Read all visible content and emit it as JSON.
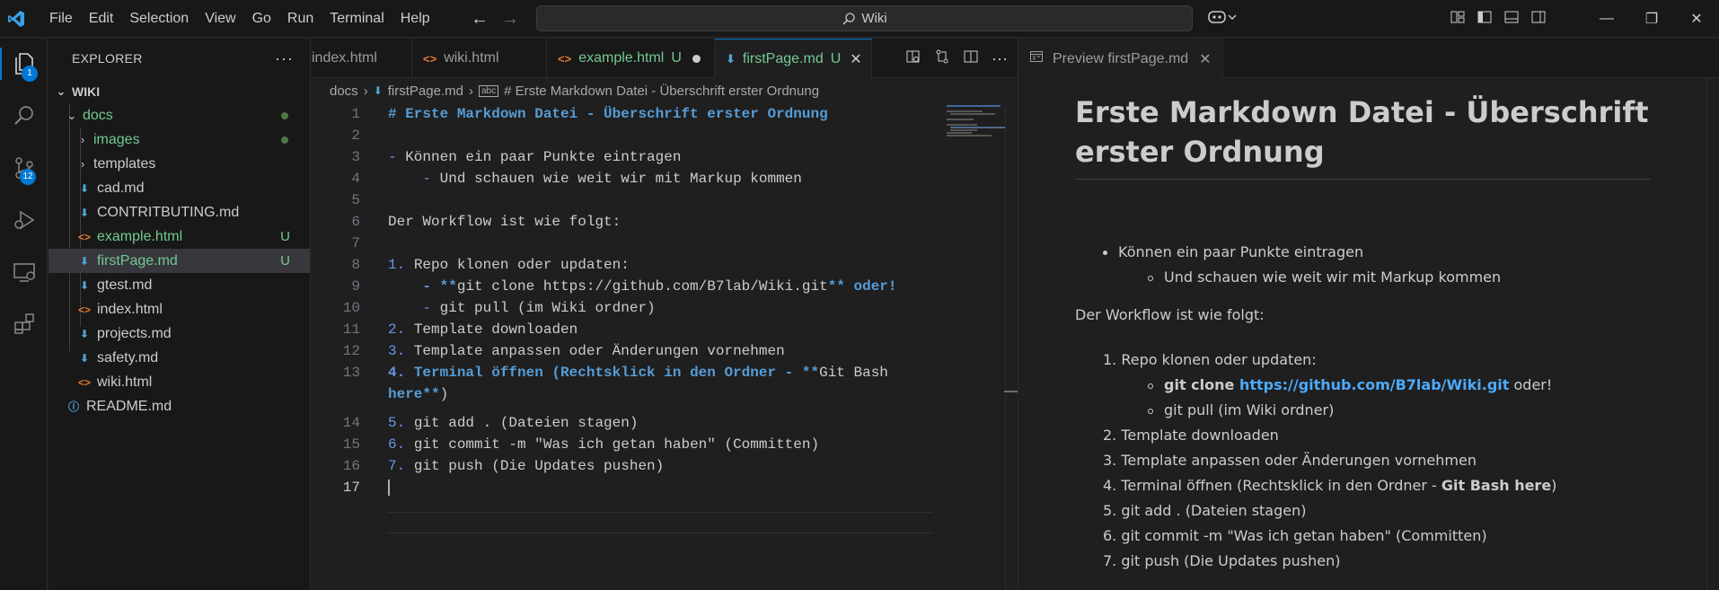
{
  "titlebar": {
    "menu": [
      "File",
      "Edit",
      "Selection",
      "View",
      "Go",
      "Run",
      "Terminal",
      "Help"
    ],
    "search_text": "Wiki"
  },
  "activitybar": {
    "explorer_badge": "1",
    "scm_badge": "12"
  },
  "sidebar": {
    "title": "EXPLORER",
    "root": "WIKI",
    "items": [
      {
        "label": "docs",
        "type": "folder-open"
      },
      {
        "label": "images",
        "type": "folder"
      },
      {
        "label": "templates",
        "type": "folder"
      },
      {
        "label": "cad.md",
        "type": "md"
      },
      {
        "label": "CONTRITBUTING.md",
        "type": "md"
      },
      {
        "label": "example.html",
        "type": "html",
        "status": "U"
      },
      {
        "label": "firstPage.md",
        "type": "md",
        "status": "U"
      },
      {
        "label": "gtest.md",
        "type": "md"
      },
      {
        "label": "index.html",
        "type": "html"
      },
      {
        "label": "projects.md",
        "type": "md"
      },
      {
        "label": "safety.md",
        "type": "md"
      },
      {
        "label": "wiki.html",
        "type": "html"
      },
      {
        "label": "README.md",
        "type": "info"
      }
    ]
  },
  "editor": {
    "tabs": [
      {
        "label": "index.html"
      },
      {
        "label": "wiki.html"
      },
      {
        "label": "example.html",
        "status": "U"
      },
      {
        "label": "firstPage.md",
        "status": "U"
      }
    ],
    "breadcrumb": [
      "docs",
      "firstPage.md",
      "# Erste Markdown Datei - Überschrift erster Ordnung"
    ],
    "lines": [
      {
        "n": "1",
        "text": "# Erste Markdown Datei - Überschrift erster Ordnung"
      },
      {
        "n": "2",
        "text": ""
      },
      {
        "n": "3",
        "text": "- Können ein paar Punkte eintragen"
      },
      {
        "n": "4",
        "text": "    - Und schauen wie weit wir mit Markup kommen"
      },
      {
        "n": "5",
        "text": ""
      },
      {
        "n": "6",
        "text": "Der Workflow ist wie folgt:"
      },
      {
        "n": "7",
        "text": ""
      },
      {
        "n": "8",
        "text": "1. Repo klonen oder updaten:"
      },
      {
        "n": "9",
        "text": "    - **git clone https://github.com/B7lab/Wiki.git** oder!"
      },
      {
        "n": "10",
        "text": "    - git pull (im Wiki ordner)"
      },
      {
        "n": "11",
        "text": "2. Template downloaden"
      },
      {
        "n": "12",
        "text": "3. Template anpassen oder Änderungen vornehmen"
      },
      {
        "n": "13",
        "text": "4. Terminal öffnen (Rechtsklick in den Ordner - **Git Bash"
      },
      {
        "n": "",
        "text": "here**)"
      },
      {
        "n": "14",
        "text": "5. git add . (Dateien stagen)"
      },
      {
        "n": "15",
        "text": "6. git commit -m \"Was ich getan haben\" (Committen)"
      },
      {
        "n": "16",
        "text": "7. git push (Die Updates pushen)"
      },
      {
        "n": "17",
        "text": ""
      }
    ]
  },
  "preview": {
    "tab_label": "Preview firstPage.md",
    "heading_line1": "Erste Markdown Datei - Überschrift",
    "heading_line2": "erster Ordnung",
    "bullet1": "Können ein paar Punkte eintragen",
    "bullet1_sub": "Und schauen wie weit wir mit Markup kommen",
    "workflow": "Der Workflow ist wie folgt:",
    "step1": "1. Repo klonen oder updaten:",
    "step1_sub1_bold": "git clone ",
    "step1_sub1_link": "https://github.com/B7lab/Wiki.git",
    "step1_sub1_rest": " oder!",
    "step1_sub2": "git pull (im Wiki ordner)",
    "step2": "2. Template downloaden",
    "step3": "3. Template anpassen oder Änderungen vornehmen",
    "step4_pre": "4. Terminal öffnen (Rechtsklick in den Ordner - ",
    "step4_bold": "Git Bash here",
    "step4_post": ")",
    "step5": "5. git add . (Dateien stagen)",
    "step6": "6. git commit -m \"Was ich getan haben\" (Committen)",
    "step7": "7. git push (Die Updates pushen)"
  },
  "colors": {
    "accent": "#0078d4",
    "untracked": "#73c991",
    "md_icon": "#4fa6d8",
    "html_icon": "#e37933"
  }
}
